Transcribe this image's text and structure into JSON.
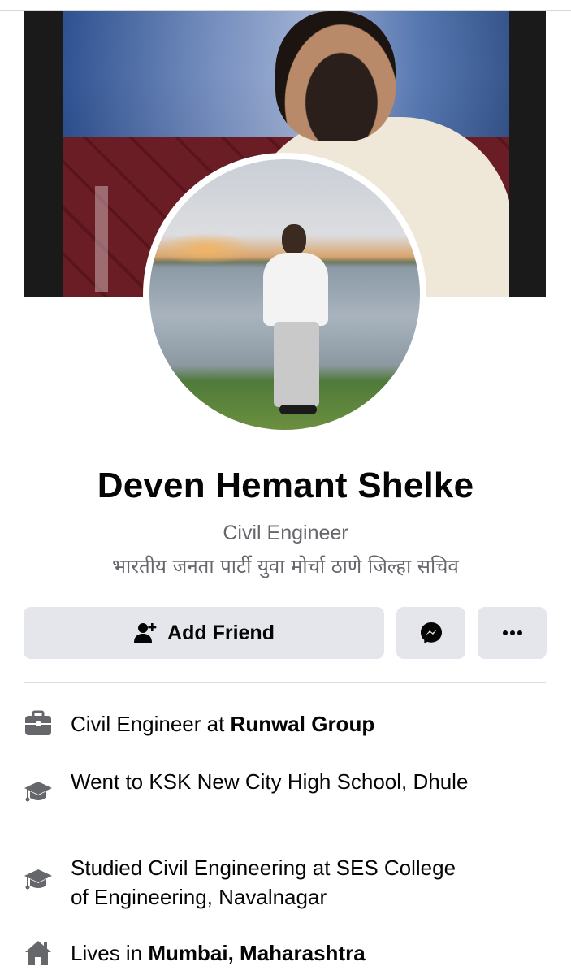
{
  "profile": {
    "name": "Deven Hemant Shelke",
    "bio_line1": "Civil Engineer",
    "bio_line2": "भारतीय जनता पार्टी युवा मोर्चा ठाणे जिल्हा सचिव"
  },
  "actions": {
    "add_friend_label": "Add Friend",
    "add_friend_icon": "add-friend-icon",
    "message_icon": "messenger-icon",
    "more_icon": "more-icon",
    "more_label": "···"
  },
  "details": {
    "work": {
      "icon": "briefcase-icon",
      "prefix": "Civil Engineer at ",
      "highlight": "Runwal Group"
    },
    "school": {
      "icon": "graduation-cap-icon",
      "text": "Went to KSK New City High School, Dhule"
    },
    "college": {
      "icon": "graduation-cap-icon",
      "text_line1": "Studied Civil Engineering at SES College",
      "text_line2": "of Engineering, Navalnagar"
    },
    "home": {
      "icon": "home-icon",
      "prefix": "Lives in ",
      "highlight": "Mumbai, Maharashtra"
    }
  },
  "colors": {
    "button_bg": "#e4e6eb",
    "secondary_text": "#65676b",
    "primary_text": "#050505",
    "icon_gray": "#65676b"
  }
}
